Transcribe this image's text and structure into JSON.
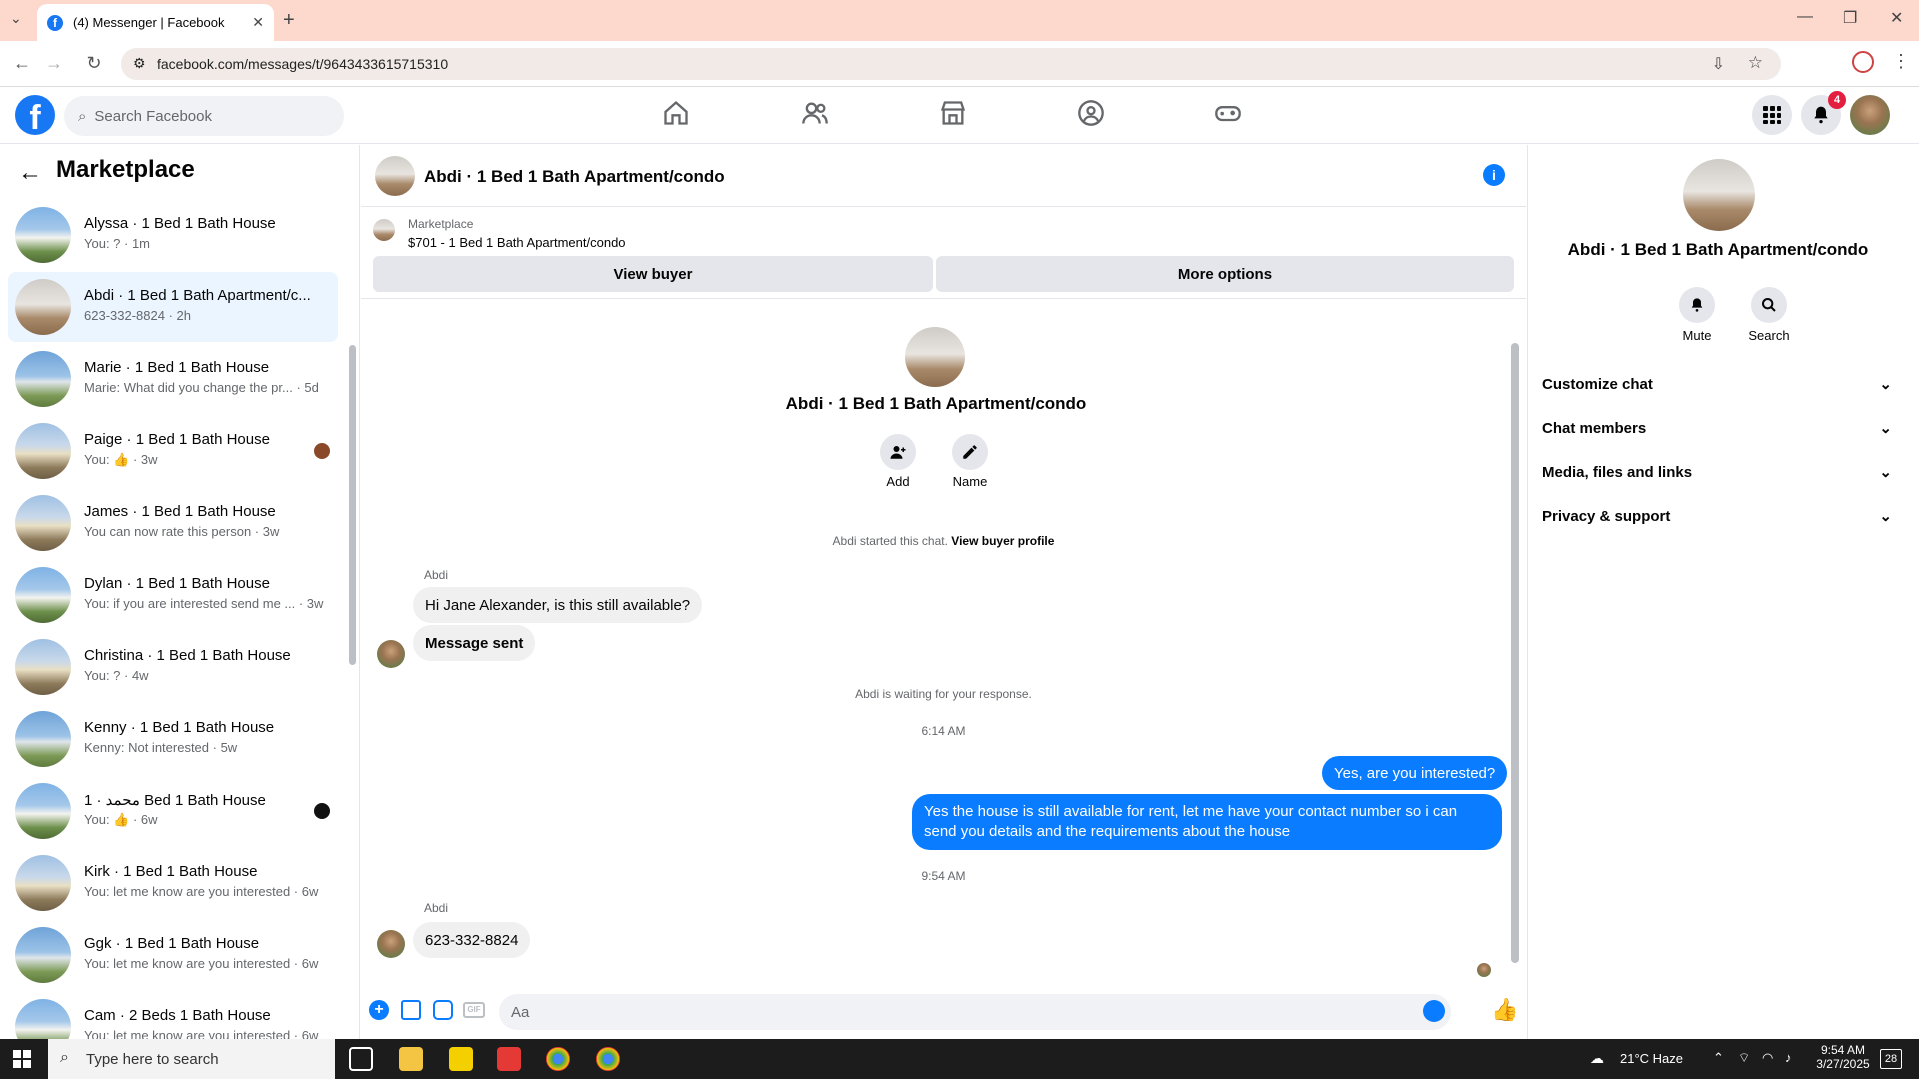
{
  "browser": {
    "tab_title": "(4) Messenger | Facebook",
    "url": "facebook.com/messages/t/9643433615715310"
  },
  "header": {
    "search_placeholder": "Search Facebook",
    "notification_count": "4"
  },
  "sidebar": {
    "title": "Marketplace",
    "conversations": [
      {
        "name": "Alyssa · 1 Bed 1 Bath House",
        "snippet": "You: ? · 1m",
        "img": "house2"
      },
      {
        "name": "Abdi · 1 Bed 1 Bath Apartment/c...",
        "snippet": "623-332-8824 · 2h",
        "img": "house",
        "active": true
      },
      {
        "name": "Marie · 1 Bed 1 Bath House",
        "snippet": "Marie: What did you change the pr... · 5d",
        "img": "house4"
      },
      {
        "name": "Paige · 1 Bed 1 Bath House",
        "snippet": "You: 👍 · 3w",
        "img": "house3"
      },
      {
        "name": "James · 1 Bed 1 Bath House",
        "snippet": "You can now rate this person · 3w",
        "img": "house3"
      },
      {
        "name": "Dylan · 1 Bed 1 Bath House",
        "snippet": "You: if you are interested send me ... · 3w",
        "img": "house2"
      },
      {
        "name": "Christina · 1 Bed 1 Bath House",
        "snippet": "You: ? · 4w",
        "img": "house3"
      },
      {
        "name": "Kenny · 1 Bed 1 Bath House",
        "snippet": "Kenny: Not interested · 5w",
        "img": "house4"
      },
      {
        "name": "محمد · 1 Bed 1 Bath House",
        "snippet": "You: 👍 · 6w",
        "img": "house2"
      },
      {
        "name": "Kirk · 1 Bed 1 Bath House",
        "snippet": "You: let me know are you interested · 6w",
        "img": "house3"
      },
      {
        "name": "Ggk · 1 Bed 1 Bath House",
        "snippet": "You: let me know are you interested · 6w",
        "img": "house4"
      },
      {
        "name": "Cam · 2 Beds 1 Bath House",
        "snippet": "You: let me know are you interested · 6w",
        "img": "house2"
      }
    ]
  },
  "chat": {
    "title": "Abdi · 1 Bed 1 Bath Apartment/condo",
    "marketplace_label": "Marketplace",
    "listing": "$701 - 1 Bed 1 Bath Apartment/condo",
    "view_buyer": "View buyer",
    "more_options": "More options",
    "profile_name": "Abdi · 1 Bed 1 Bath Apartment/condo",
    "add_label": "Add",
    "name_label": "Name",
    "started_text": "Abdi started this chat.",
    "view_buyer_profile": "View buyer profile",
    "sender": "Abdi",
    "msg1": "Hi Jane Alexander, is this still available?",
    "msg2": "Message sent",
    "waiting": "Abdi is waiting for your response.",
    "time1": "6:14 AM",
    "out1": "Yes, are you interested?",
    "out2": "Yes the house is still available for rent, let me have your contact number so i can send you details and the requirements about the house",
    "time2": "9:54 AM",
    "sender2": "Abdi",
    "msg3": "623-332-8824",
    "composer_placeholder": "Aa"
  },
  "details": {
    "name": "Abdi · 1 Bed 1 Bath Apartment/condo",
    "mute": "Mute",
    "search": "Search",
    "sections": [
      "Customize chat",
      "Chat members",
      "Media, files and links",
      "Privacy & support"
    ]
  },
  "taskbar": {
    "search_placeholder": "Type here to search",
    "weather": "21°C  Haze",
    "time": "9:54 AM",
    "date": "3/27/2025",
    "notif": "28"
  }
}
